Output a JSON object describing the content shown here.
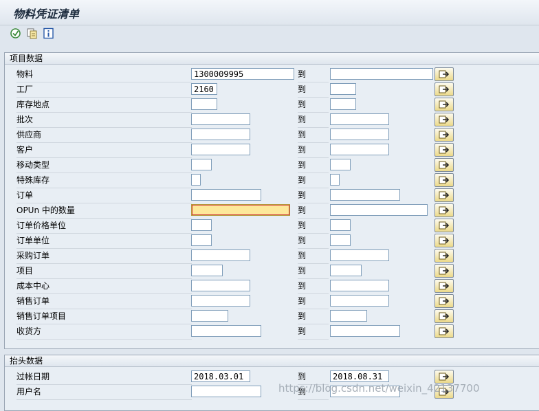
{
  "window": {
    "title": "物料凭证清单"
  },
  "toolbar": {
    "execute_icon": "execute-icon",
    "variant_icon": "get-variant-icon",
    "info_icon": "info-icon"
  },
  "sections": {
    "items": {
      "header": "项目数据",
      "rows": [
        {
          "label": "物料",
          "low": "1300009995",
          "high": ""
        },
        {
          "label": "工厂",
          "low": "2160",
          "high": ""
        },
        {
          "label": "库存地点",
          "low": "",
          "high": ""
        },
        {
          "label": "批次",
          "low": "",
          "high": ""
        },
        {
          "label": "供应商",
          "low": "",
          "high": ""
        },
        {
          "label": "客户",
          "low": "",
          "high": ""
        },
        {
          "label": "移动类型",
          "low": "",
          "high": ""
        },
        {
          "label": "特殊库存",
          "low": "",
          "high": ""
        },
        {
          "label": "订单",
          "low": "",
          "high": ""
        },
        {
          "label": "OPUn 中的数量",
          "low": "",
          "high": ""
        },
        {
          "label": "订单价格单位",
          "low": "",
          "high": ""
        },
        {
          "label": "订单单位",
          "low": "",
          "high": ""
        },
        {
          "label": "采购订单",
          "low": "",
          "high": ""
        },
        {
          "label": "项目",
          "low": "",
          "high": ""
        },
        {
          "label": "成本中心",
          "low": "",
          "high": ""
        },
        {
          "label": "销售订单",
          "low": "",
          "high": ""
        },
        {
          "label": "销售订单项目",
          "low": "",
          "high": ""
        },
        {
          "label": "收货方",
          "low": "",
          "high": ""
        }
      ]
    },
    "header_data": {
      "header": "抬头数据",
      "rows": [
        {
          "label": "过帐日期",
          "low": "2018.03.01",
          "high": "2018.08.31"
        },
        {
          "label": "用户名",
          "low": "",
          "high": ""
        }
      ]
    }
  },
  "range_to_label": "到",
  "watermark": "https://blog.csdn.net/weixin_42137700",
  "colors": {
    "background": "#dfe6ee",
    "focus_field": "#fde89a",
    "select_button": "#ecd98a"
  }
}
